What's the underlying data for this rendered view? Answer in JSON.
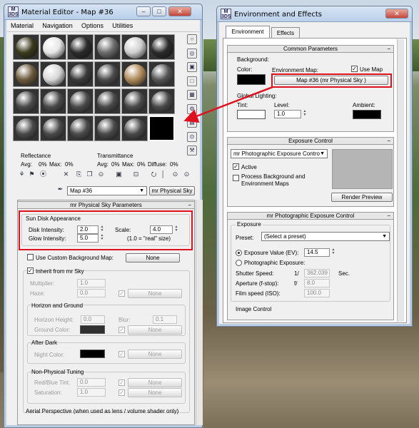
{
  "background": {
    "sky": "#c9d7e6",
    "grass": "#4f6b3a"
  },
  "material_editor": {
    "title": "Material Editor - Map #36",
    "controls": {
      "minimize": "–",
      "maximize": "□",
      "close": "✕"
    },
    "menu": [
      "Material",
      "Navigation",
      "Options",
      "Utilities"
    ],
    "reflectance": {
      "label": "Reflectance",
      "avg_label": "Avg:",
      "avg": "0%",
      "max_label": "Max:",
      "max": "0%"
    },
    "transmittance": {
      "label": "Transmittance",
      "avg_label": "Avg:",
      "avg": "0%",
      "max_label": "Max:",
      "max": "0%",
      "diffuse_label": "Diffuse:",
      "diffuse": "0%"
    },
    "map_name": "Map #36",
    "map_type_button": "mr Physical Sky",
    "rollout_title": "mr Physical Sky Parameters",
    "sun_disk": {
      "title": "Sun Disk Appearance",
      "disk_intensity_label": "Disk Intensity:",
      "disk_intensity": "2.0",
      "scale_label": "Scale:",
      "scale": "4.0",
      "glow_intensity_label": "Glow Intensity:",
      "glow_intensity": "5.0",
      "note": "(1.0 = \"real\" size)"
    },
    "custom_bg": {
      "label": "Use Custom Background Map:",
      "button": "None",
      "checked": false
    },
    "inherit": {
      "label": "Inherit from mr Sky",
      "checked": true,
      "multiplier_label": "Multiplier:",
      "multiplier": "1.0",
      "haze_label": "Haze:",
      "haze": "0.0",
      "none": "None"
    },
    "horizon": {
      "title": "Horizon and Ground",
      "height_label": "Horizon Height:",
      "height": "0.0",
      "blur_label": "Blur:",
      "blur": "0.1",
      "ground_label": "Ground Color:",
      "none": "None"
    },
    "after_dark": {
      "title": "After Dark",
      "night_label": "Night Color:",
      "none": "None"
    },
    "non_physical": {
      "title": "Non-Physical Tuning",
      "tint_label": "Red/Blue Tint:",
      "tint": "0.0",
      "saturation_label": "Saturation:",
      "saturation": "1.0",
      "none": "None"
    },
    "aerial_label": "Aerial Perspective (when used as lens / volume shader only)",
    "side_icons": [
      "○",
      "◎",
      "▣",
      "□",
      "▦",
      "⚙",
      "▤",
      "⊙",
      "⚒"
    ],
    "toolbar_icons": [
      "⚘",
      "⚑",
      "⦿",
      "✕",
      "⎘",
      "❐",
      "⊙",
      "▣",
      "⊡",
      "⭮",
      "│",
      "⊙",
      "⊙"
    ],
    "sphere_colors": [
      [
        "#3a3a1c",
        "#e6e6e6",
        "#2b2b2b",
        "#6b6b6b",
        "#cfcfcf",
        "#2a2a2a"
      ],
      [
        "#6b5a3c",
        "#d8d8d8",
        "#3a3a3a",
        "#4b4b4b",
        "#b08a5a",
        "#555555"
      ],
      [
        "#4a4a4a",
        "#4a4a4a",
        "#4a4a4a",
        "#4a4a4a",
        "#4a4a4a",
        "#4a4a4a"
      ],
      [
        "#4a4a4a",
        "#4a4a4a",
        "#4a4a4a",
        "#4a4a4a",
        "#4a4a4a",
        "#000000"
      ]
    ]
  },
  "env_effects": {
    "title": "Environment and Effects",
    "controls": {
      "close": "✕"
    },
    "tabs": [
      "Environment",
      "Effects"
    ],
    "common_params": "Common Parameters",
    "background_label": "Background:",
    "color_label": "Color:",
    "env_map_label": "Environment Map:",
    "use_map_label": "Use Map",
    "env_map_button": "Map #36  (mr Physical Sky )",
    "global_lighting": "Global Lighting:",
    "tint_label": "Tint:",
    "level_label": "Level:",
    "level": "1.0",
    "ambient_label": "Ambient:",
    "exposure_control": "Exposure Control",
    "exposure_type": "mr Photographic Exposure Contro",
    "active_label": "Active",
    "process_bg_label": "Process Background and Environment Maps",
    "render_preview": "Render Preview",
    "mr_exposure_title": "mr Photographic Exposure Control",
    "exposure_section": "Exposure",
    "preset_label": "Preset:",
    "preset_value": "(Select a preset)",
    "ev_label": "Exposure Value (EV):",
    "ev": "14.5",
    "photo_label": "Photographic Exposure:",
    "shutter_label": "Shutter Speed:",
    "shutter_prefix": "1/",
    "shutter": "362.039",
    "shutter_unit": "Sec.",
    "aperture_label": "Aperture (f-stop):",
    "aperture_prefix": "f/",
    "aperture": "8.0",
    "film_label": "Film speed (ISO):",
    "film": "100.0",
    "image_control": "Image Control"
  }
}
